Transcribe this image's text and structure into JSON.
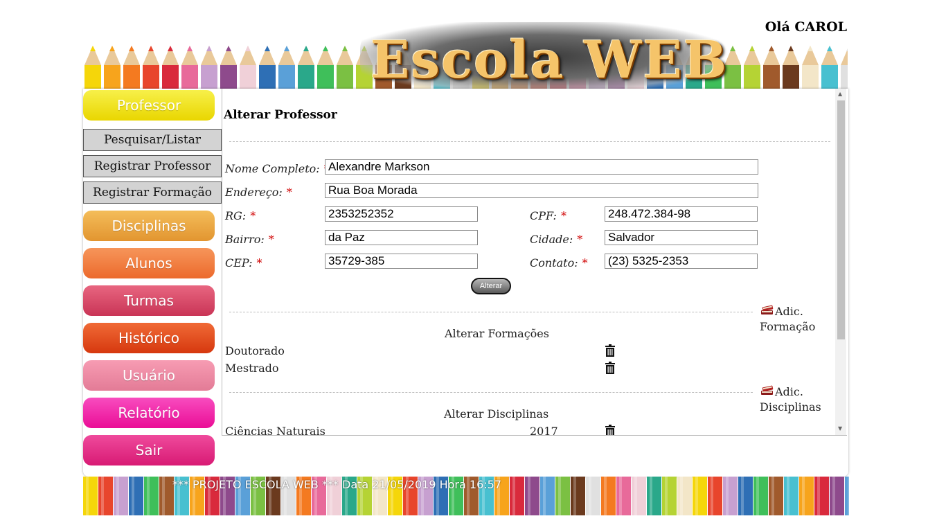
{
  "header": {
    "logo_text": "Escola WEB",
    "greeting": "Olá CAROL"
  },
  "sidebar": {
    "items": [
      {
        "label": "Professor",
        "color": "#f2e000"
      },
      {
        "label": "Pesquisar/Listar"
      },
      {
        "label": "Registrar Professor"
      },
      {
        "label": "Registrar Formação"
      },
      {
        "label": "Disciplinas",
        "color": "#eaa33c"
      },
      {
        "label": "Alunos",
        "color": "#f07d3c"
      },
      {
        "label": "Turmas",
        "color": "#d94a66"
      },
      {
        "label": "Histórico",
        "color": "#e3471c"
      },
      {
        "label": "Usuário",
        "color": "#ee8fa4"
      },
      {
        "label": "Relatório",
        "color": "#f01fa5"
      },
      {
        "label": "Sair",
        "color": "#e02884"
      }
    ]
  },
  "form": {
    "title": "Alterar Professor",
    "nome_label": "Nome Completo:",
    "nome_value": "Alexandre Markson",
    "endereco_label": "Endereço:",
    "endereco_value": "Rua Boa Morada",
    "rg_label": "RG:",
    "rg_value": "2353252352",
    "cpf_label": "CPF:",
    "cpf_value": "248.472.384-98",
    "bairro_label": "Bairro:",
    "bairro_value": "da Paz",
    "cidade_label": "Cidade:",
    "cidade_value": "Salvador",
    "cep_label": "CEP:",
    "cep_value": "35729-385",
    "contato_label": "Contato:",
    "contato_value": "(23) 5325-2353",
    "required_mark": "*",
    "submit_label": "Alterar"
  },
  "formacoes": {
    "add_label": "Adic.",
    "add_label_2": "Formação",
    "title": "Alterar Formações",
    "items": [
      "Doutorado",
      "Mestrado"
    ]
  },
  "disciplinas": {
    "add_label": "Adic.",
    "add_label_2": "Disciplinas",
    "title": "Alterar Disciplinas",
    "items": [
      {
        "name": "Ciências Naturais",
        "year": "2017"
      }
    ]
  },
  "footer": {
    "text": "*** PROJETO ESCOLA WEB *** Data 21/05/2019 Hora 16:57"
  }
}
